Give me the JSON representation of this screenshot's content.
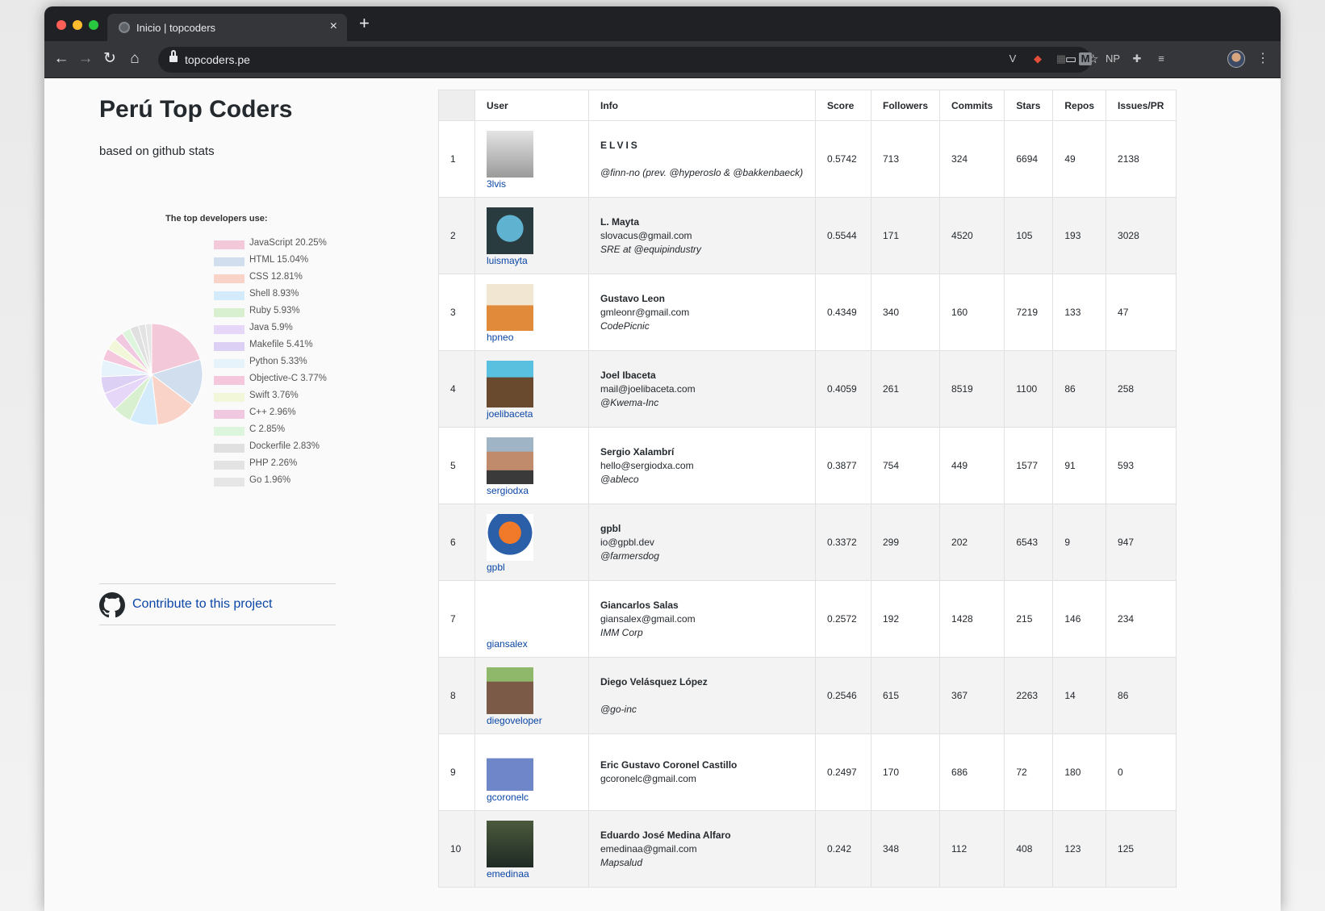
{
  "browser": {
    "tab_title": "Inicio | topcoders",
    "tab_close": "×",
    "new_tab": "+",
    "url": "topcoders.pe",
    "extensions": [
      "V",
      "M",
      "NP"
    ]
  },
  "page": {
    "title": "Perú Top Coders",
    "subtitle": "based on github stats",
    "contribute_label": "Contribute to this project"
  },
  "chart_data": {
    "type": "pie",
    "title": "The top developers use:",
    "legend_position": "right",
    "categories": [
      "JavaScript",
      "HTML",
      "CSS",
      "Shell",
      "Ruby",
      "Java",
      "Makefile",
      "Python",
      "Objective-C",
      "Swift",
      "C++",
      "C",
      "Dockerfile",
      "PHP",
      "Go"
    ],
    "values": [
      20.25,
      15.04,
      12.81,
      8.93,
      5.93,
      5.9,
      5.41,
      5.33,
      3.77,
      3.76,
      2.96,
      2.85,
      2.83,
      2.26,
      1.96
    ],
    "labels": [
      "JavaScript 20.25%",
      "HTML 15.04%",
      "CSS 12.81%",
      "Shell 8.93%",
      "Ruby 5.93%",
      "Java 5.9%",
      "Makefile 5.41%",
      "Python 5.33%",
      "Objective-C 3.77%",
      "Swift 3.76%",
      "C++ 2.96%",
      "C 2.85%",
      "Dockerfile 2.83%",
      "PHP 2.26%",
      "Go 1.96%"
    ],
    "colors": [
      "#f3c9d9",
      "#d0deee",
      "#f9d3c7",
      "#d3ebfa",
      "#d9f0d0",
      "#e6d6f7",
      "#dcd0f5",
      "#e6f3fb",
      "#f5c7dc",
      "#f2f7d9",
      "#f0c8df",
      "#dcf5dc",
      "#e0e0e0",
      "#e3e3e3",
      "#e6e6e6"
    ]
  },
  "table": {
    "headers": [
      "",
      "User",
      "Info",
      "Score",
      "Followers",
      "Commits",
      "Stars",
      "Repos",
      "Issues/PR"
    ],
    "rows": [
      {
        "rank": "1",
        "login": "3lvis",
        "name": "ELVIS",
        "email": "",
        "bio": "@finn-no (prev. @hyperoslo & @bakkenbaeck)",
        "score": "0.5742",
        "followers": "713",
        "commits": "324",
        "stars": "6694",
        "repos": "49",
        "issues": "2138"
      },
      {
        "rank": "2",
        "login": "luismayta",
        "name": "L. Mayta",
        "email": "slovacus@gmail.com",
        "bio": "SRE at @equipindustry",
        "score": "0.5544",
        "followers": "171",
        "commits": "4520",
        "stars": "105",
        "repos": "193",
        "issues": "3028"
      },
      {
        "rank": "3",
        "login": "hpneo",
        "name": "Gustavo Leon",
        "email": "gmleonr@gmail.com",
        "bio": "CodePicnic",
        "score": "0.4349",
        "followers": "340",
        "commits": "160",
        "stars": "7219",
        "repos": "133",
        "issues": "47"
      },
      {
        "rank": "4",
        "login": "joelibaceta",
        "name": "Joel Ibaceta",
        "email": "mail@joelibaceta.com",
        "bio": "@Kwema-Inc",
        "score": "0.4059",
        "followers": "261",
        "commits": "8519",
        "stars": "1100",
        "repos": "86",
        "issues": "258"
      },
      {
        "rank": "5",
        "login": "sergiodxa",
        "name": "Sergio Xalambrí",
        "email": "hello@sergiodxa.com",
        "bio": "@ableco",
        "score": "0.3877",
        "followers": "754",
        "commits": "449",
        "stars": "1577",
        "repos": "91",
        "issues": "593"
      },
      {
        "rank": "6",
        "login": "gpbl",
        "name": "gpbl",
        "email": "io@gpbl.dev",
        "bio": "@farmersdog",
        "score": "0.3372",
        "followers": "299",
        "commits": "202",
        "stars": "6543",
        "repos": "9",
        "issues": "947"
      },
      {
        "rank": "7",
        "login": "giansalex",
        "name": "Giancarlos Salas",
        "email": "giansalex@gmail.com",
        "bio": "IMM Corp",
        "score": "0.2572",
        "followers": "192",
        "commits": "1428",
        "stars": "215",
        "repos": "146",
        "issues": "234"
      },
      {
        "rank": "8",
        "login": "diegoveloper",
        "name": "Diego Velásquez López",
        "email": "",
        "bio": "@go-inc",
        "score": "0.2546",
        "followers": "615",
        "commits": "367",
        "stars": "2263",
        "repos": "14",
        "issues": "86"
      },
      {
        "rank": "9",
        "login": "gcoronelc",
        "name": "Eric Gustavo Coronel Castillo",
        "email": "gcoronelc@gmail.com",
        "bio": "",
        "score": "0.2497",
        "followers": "170",
        "commits": "686",
        "stars": "72",
        "repos": "180",
        "issues": "0"
      },
      {
        "rank": "10",
        "login": "emedinaa",
        "name": "Eduardo José Medina Alfaro",
        "email": "emedinaa@gmail.com",
        "bio": "Mapsalud",
        "score": "0.242",
        "followers": "348",
        "commits": "112",
        "stars": "408",
        "repos": "123",
        "issues": "125"
      }
    ]
  }
}
